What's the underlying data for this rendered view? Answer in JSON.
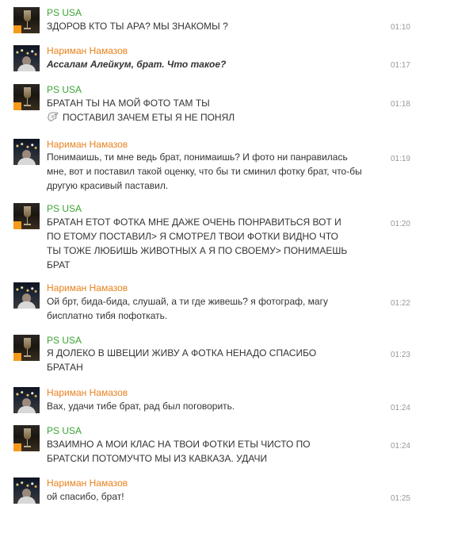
{
  "messages": [
    {
      "author": "PS USA",
      "kind": "ps",
      "lines": [
        "ЗДОРОВ КТО ТЫ АРА? МЫ ЗНАКОМЫ ?"
      ],
      "time": "01:10"
    },
    {
      "author": "Нариман Намазов",
      "kind": "nm",
      "lines": [
        "Ассалам Алейкум, брат. Что такое?"
      ],
      "style": "italic-bold",
      "time": "01:17"
    },
    {
      "author": "PS USA",
      "kind": "ps",
      "lines": [
        "БРАТАН ТЫ НА МОЙ ФОТО ТАМ ТЫ",
        "ПОСТАВИЛ ЗАЧЕМ ЕТЫ Я НЕ ПОНЯЛ"
      ],
      "time": "01:18",
      "icon": "thinking-hand-icon"
    },
    {
      "author": "Нариман Намазов",
      "kind": "nm",
      "lines": [
        "Понимаишь, ти мне ведь брат, понимаишь? И фото ни панравилась",
        "мне, вот и поставил такой оценку, что бы ти сминил фотку брат, что-бы",
        "другую красивый паставил."
      ],
      "time": "01:19"
    },
    {
      "author": "PS USA",
      "kind": "ps",
      "lines": [
        "БРАТАН ЕТОТ ФОТКА МНЕ ДАЖЕ ОЧЕНЬ ПОНРАВИТЬСЯ ВОТ И",
        " ПО ЕТОМУ ПОСТАВИЛ> Я СМОТРЕЛ ТВОИ ФОТКИ ВИДНО ЧТО",
        " ТЫ ТОЖЕ ЛЮБИШЬ ЖИВОТНЫХ А Я ПО СВОЕМУ> ПОНИМАЕШЬ",
        "БРАТ"
      ],
      "time": "01:20"
    },
    {
      "author": "Нариман Намазов",
      "kind": "nm",
      "lines": [
        "Ой брт, бида-бида, слушай, а ти где живешь? я фотограф, магу",
        "бисплатно тибя пофоткать."
      ],
      "time": "01:22"
    },
    {
      "author": "PS USA",
      "kind": "ps",
      "lines": [
        "Я ДОЛЕКО В ШВЕЦИИ ЖИВУ А ФОТКА НЕНАДО СПАСИБО",
        " БРАТАН"
      ],
      "time": "01:23"
    },
    {
      "author": "Нариман Намазов",
      "kind": "nm",
      "lines": [
        "Вах, удачи тибе брат, рад был поговорить."
      ],
      "time": "01:24"
    },
    {
      "author": "PS USA",
      "kind": "ps",
      "lines": [
        "ВЗАИМНО А МОИ КЛАС НА ТВОИ ФОТКИ ЕТЫ ЧИСТО ПО",
        " БРАТСКИ ПОТОМУЧТО МЫ ИЗ КАВКАЗА. УДАЧИ"
      ],
      "time": "01:24"
    },
    {
      "author": "Нариман Намазов",
      "kind": "nm",
      "lines": [
        "ой спасибо, брат!"
      ],
      "time": "01:25"
    }
  ]
}
